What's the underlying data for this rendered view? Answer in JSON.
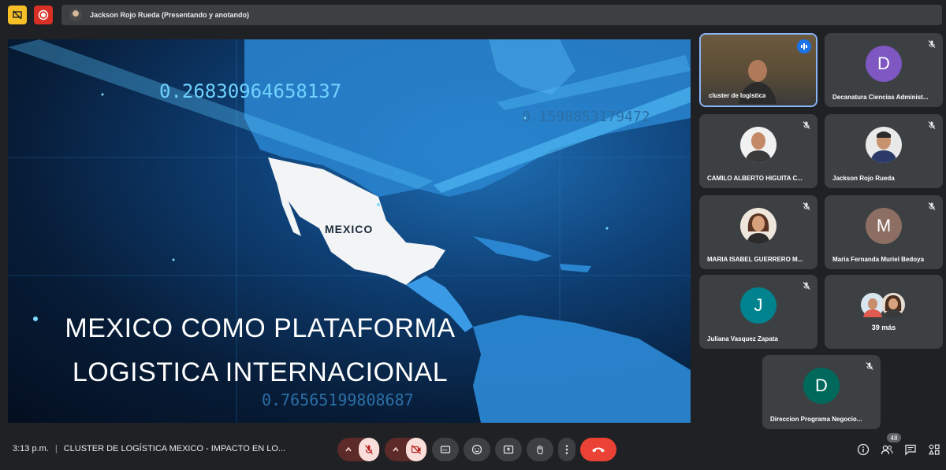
{
  "colors": {
    "background": "#202124",
    "tile": "#3c4043",
    "accent": "#8ab4f8",
    "danger": "#ea4335",
    "warning": "#f6c026"
  },
  "top_bar": {
    "presenter_label": "Jackson Rojo Rueda (Presentando y anotando)",
    "icons": [
      "no-present-icon",
      "record-icon"
    ]
  },
  "slide": {
    "title_line1": "MEXICO COMO PLATAFORMA",
    "title_line2": "LOGISTICA INTERNACIONAL",
    "map_label": "MEXICO",
    "digits_1": "0.26830964658137",
    "digits_2": "0.1598853179472",
    "digits_3": "0.76565199808687"
  },
  "participants": [
    {
      "name": "cluster de logistica",
      "type": "camera",
      "speaking": true
    },
    {
      "name": "Decanatura Ciencias Administ...",
      "initial": "D",
      "color": "#7e57c2",
      "muted": true
    },
    {
      "name": "CAMILO ALBERTO HIGUITA C...",
      "type": "photo",
      "muted": true
    },
    {
      "name": "Jackson Rojo Rueda",
      "type": "photo",
      "muted": true
    },
    {
      "name": "MARIA ISABEL GUERRERO M...",
      "type": "photo",
      "muted": true
    },
    {
      "name": "Maria Fernanda Muriel Bedoya",
      "initial": "M",
      "color": "#8d6e63",
      "muted": true
    },
    {
      "name": "Juliana Vasquez Zapata",
      "initial": "J",
      "color": "#00838f",
      "muted": true
    },
    {
      "name": "39 más",
      "type": "overflow"
    },
    {
      "name": "Direccion Programa Negocio...",
      "initial": "D",
      "color": "#00695c",
      "muted": true
    }
  ],
  "bottom_bar": {
    "time": "3:13 p.m.",
    "meeting_title": "CLUSTER DE LOGÍSTICA MEXICO - IMPACTO EN LO...",
    "participant_count": "48",
    "controls": [
      "mic-off",
      "camera-off",
      "captions",
      "emoji",
      "present",
      "raise-hand",
      "more-options",
      "leave-call"
    ],
    "right_controls": [
      "info",
      "people",
      "chat",
      "activities"
    ]
  }
}
